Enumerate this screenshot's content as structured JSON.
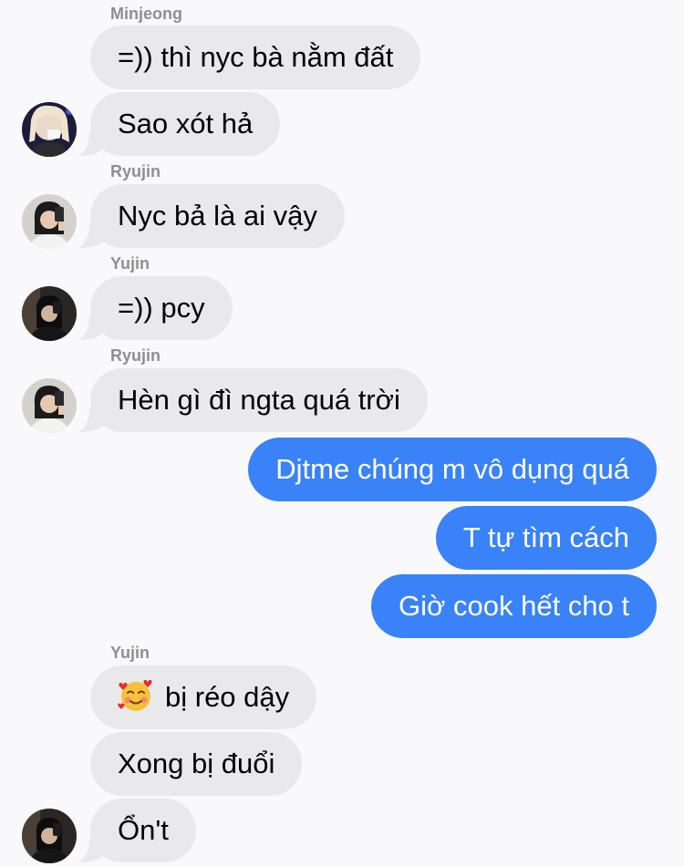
{
  "messages": [
    {
      "sender": "Minjeong",
      "text": "=)) thì nyc bà nằm đất"
    },
    {
      "text": "Sao xót hả",
      "avatar": "avatar-minjeong"
    },
    {
      "sender": "Ryujin",
      "text": "Nyc bả là ai vậy",
      "avatar": "avatar-ryujin"
    },
    {
      "sender": "Yujin",
      "text": "=)) pcy",
      "avatar": "avatar-yujin"
    },
    {
      "sender": "Ryujin",
      "text": "Hèn gì đì ngta quá trời",
      "avatar": "avatar-ryujin"
    },
    {
      "text": "Djtme chúng m vô dụng quá",
      "outgoing": true
    },
    {
      "text": "T tự tìm cách",
      "outgoing": true
    },
    {
      "text": "Giờ cook hết cho t",
      "outgoing": true
    },
    {
      "sender": "Yujin",
      "text": "bị réo dậy",
      "emoji": "smiling-face-with-hearts-emoji"
    },
    {
      "text": "Xong bị đuổi"
    },
    {
      "text": "Ổn't",
      "avatar": "avatar-yujin"
    }
  ],
  "colors": {
    "background": "#f9f9fb",
    "incoming_bubble": "#e9e9eb",
    "outgoing_bubble": "#3a82f7",
    "sender_name": "#8e8e93"
  }
}
